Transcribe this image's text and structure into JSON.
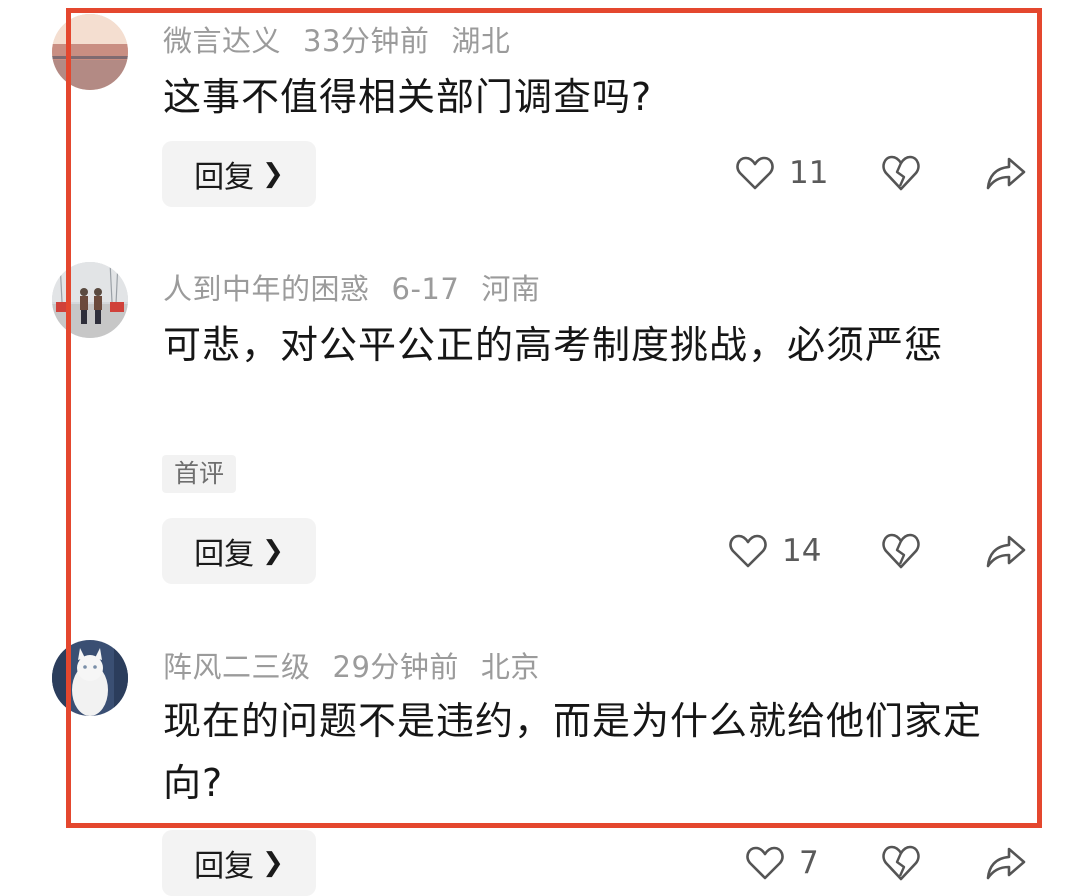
{
  "comments": [
    {
      "author": "微言达义",
      "time": "33分钟前",
      "location": "湖北",
      "text": "这事不值得相关部门调查吗?",
      "badge": "",
      "reply_label": "回复",
      "likes": "11"
    },
    {
      "author": "人到中年的困惑",
      "time": "6-17",
      "location": "河南",
      "text": "可悲，对公平公正的高考制度挑战，必须严惩",
      "badge": "首评",
      "reply_label": "回复",
      "likes": "14"
    },
    {
      "author": "阵风二三级",
      "time": "29分钟前",
      "location": "北京",
      "text": "现在的问题不是违约，而是为什么就给他们家定向?",
      "badge": "",
      "reply_label": "回复",
      "likes": "7"
    }
  ],
  "icons": {
    "reply_chevron": "chevron-right-icon",
    "like": "heart-icon",
    "dislike": "broken-heart-icon",
    "share": "share-arrow-icon"
  },
  "colors": {
    "highlight_border": "#e4472e",
    "meta_text": "#9b9b9b",
    "body_text": "#161616",
    "button_bg": "#f3f3f3"
  }
}
